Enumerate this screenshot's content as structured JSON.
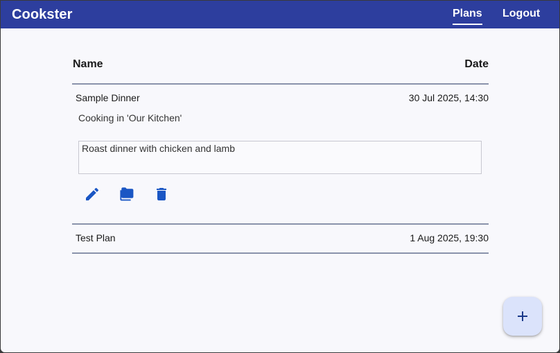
{
  "app": {
    "title": "Cookster"
  },
  "nav": {
    "plans_label": "Plans",
    "logout_label": "Logout"
  },
  "table": {
    "columns": [
      "Name",
      "Date"
    ],
    "rows": [
      {
        "name": "Sample Dinner",
        "date": "30 Jul 2025, 14:30",
        "expanded": true,
        "kitchen_text": "Cooking in 'Our Kitchen'",
        "notes": "Roast dinner with chicken and lamb",
        "actions": [
          "edit-icon",
          "folder-icon",
          "delete-icon"
        ]
      },
      {
        "name": "Test Plan",
        "date": "1 Aug 2025, 19:30",
        "expanded": false
      }
    ]
  },
  "fab": {
    "icon": "plus-icon"
  },
  "colors": {
    "header_bg": "#2d3e9e",
    "accent_icon": "#1a56c4",
    "fab_bg": "#dbe3fb",
    "page_bg": "#f8f8fc"
  }
}
